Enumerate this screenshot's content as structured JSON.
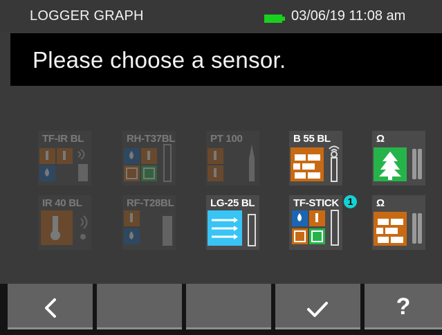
{
  "status": {
    "title": "LOGGER GRAPH",
    "datetime": "03/06/19 11:08 am",
    "battery_color": "#19d01f"
  },
  "prompt": "Please choose a sensor.",
  "sensors": [
    {
      "label": "TF-IR BL",
      "enabled": false,
      "icons": [
        "thermometer-icon",
        "thermometer-icon",
        "wireless-icon",
        "water-drop-icon",
        "probe-icon"
      ]
    },
    {
      "label": "RH-T37BL",
      "enabled": false,
      "icons": [
        "water-drop-icon",
        "thermometer-icon",
        "probe-icon",
        "wall-grid-icon",
        "wall-grid-icon"
      ]
    },
    {
      "label": "PT 100",
      "enabled": false,
      "icons": [
        "thermometer-icon",
        "thermometer-icon",
        "needle-probe-icon"
      ]
    },
    {
      "label": "B 55 BL",
      "enabled": true,
      "icons": [
        "brick-wall-icon",
        "wireless-probe-icon"
      ]
    },
    {
      "label": "Ω",
      "enabled": true,
      "icons": [
        "tree-icon",
        "electrode-pins-icon"
      ]
    },
    {
      "label": "IR 40 BL",
      "enabled": false,
      "icons": [
        "infrared-thermometer-icon",
        "wireless-icon"
      ]
    },
    {
      "label": "RF-T28BL",
      "enabled": false,
      "icons": [
        "thermometer-icon",
        "water-drop-icon",
        "probe-icon"
      ]
    },
    {
      "label": "LG-25 BL",
      "enabled": true,
      "icons": [
        "airflow-icon",
        "probe-icon"
      ]
    },
    {
      "label": "TF-STICK",
      "enabled": true,
      "badge": "1",
      "icons": [
        "water-drop-icon",
        "thermometer-icon",
        "wall-grid-icon",
        "wall-grid-icon",
        "stick-probe-icon"
      ]
    },
    {
      "label": "Ω",
      "enabled": true,
      "icons": [
        "brick-wall-icon",
        "electrode-pins-icon"
      ]
    }
  ],
  "nav": [
    {
      "name": "back-button",
      "icon": "chevron-left-icon",
      "label": "<"
    },
    {
      "name": "blank-button-1",
      "icon": "",
      "label": ""
    },
    {
      "name": "blank-button-2",
      "icon": "",
      "label": ""
    },
    {
      "name": "confirm-button",
      "icon": "checkmark-icon",
      "label": "✓"
    },
    {
      "name": "help-button",
      "icon": "question-icon",
      "label": "?"
    }
  ],
  "colors": {
    "orange": "#c86a14",
    "blue": "#1a66b3",
    "green": "#26b44a",
    "cyan": "#38c4f4",
    "badge": "#14d3d3"
  }
}
